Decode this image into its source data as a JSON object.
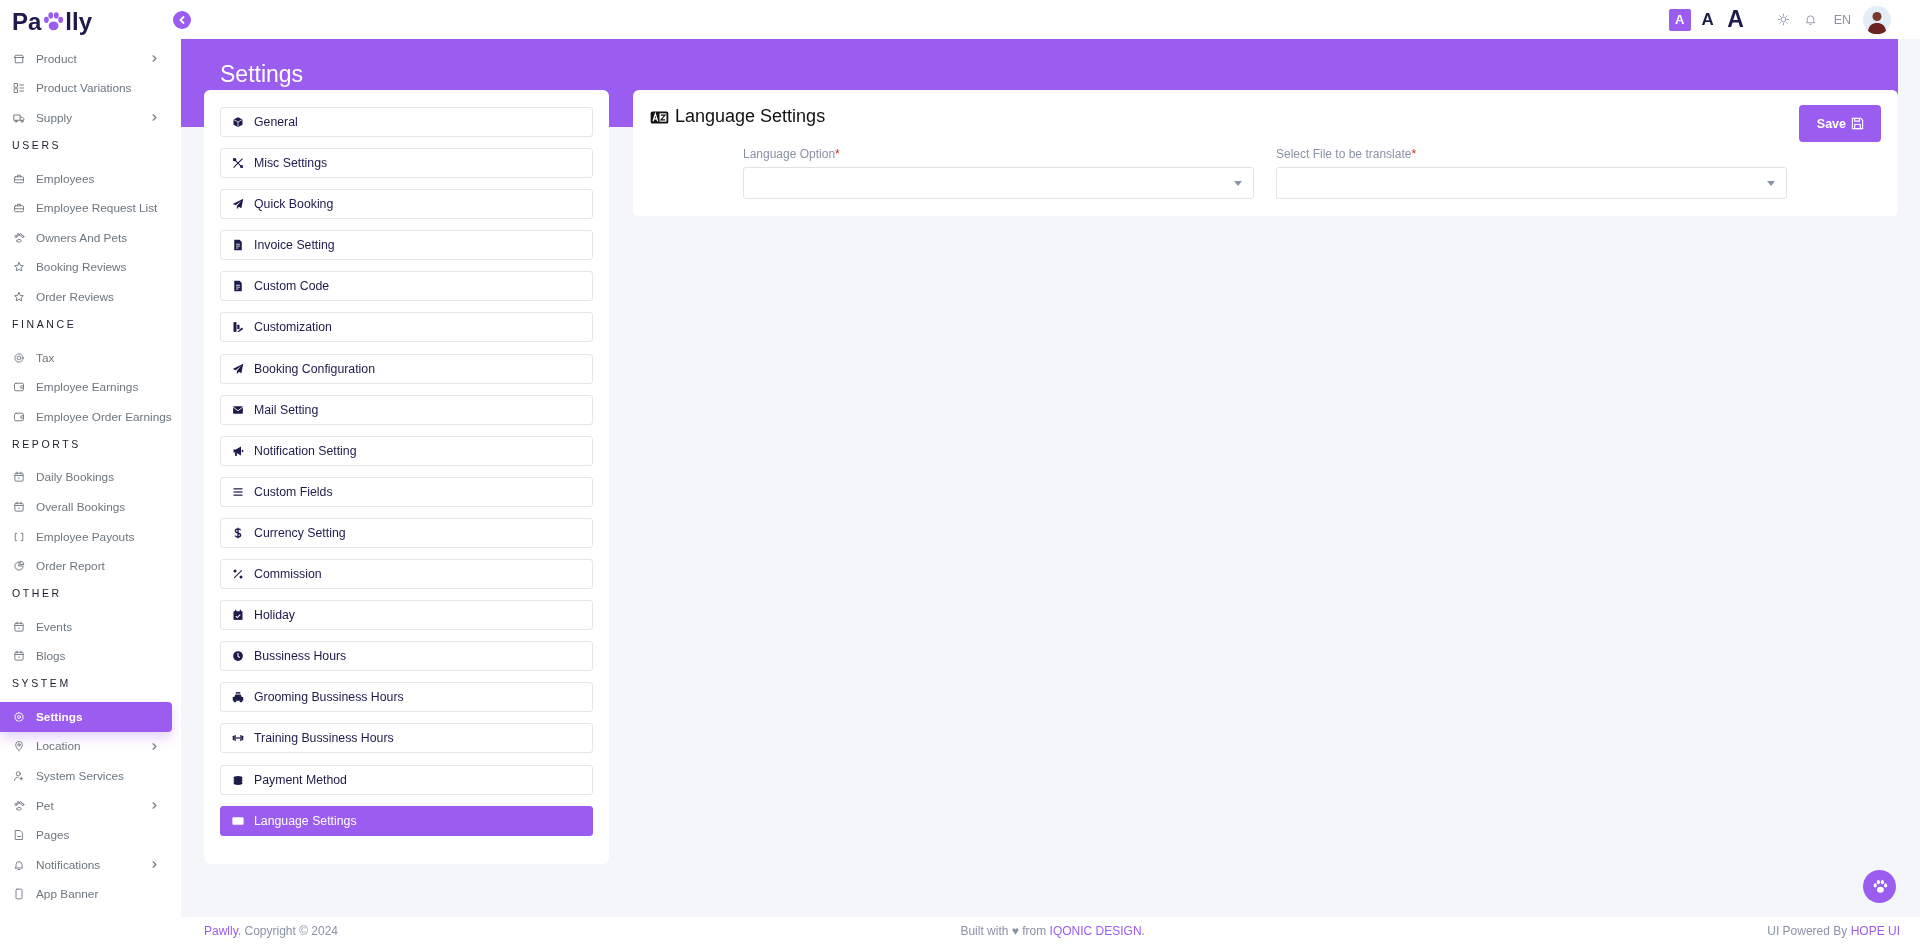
{
  "logo": {
    "parts": [
      "Pa",
      "lly"
    ]
  },
  "header": {
    "font_sizes": [
      {
        "label": "A",
        "selected": true
      },
      {
        "label": "A",
        "selected": false
      },
      {
        "label": "A",
        "selected": false
      }
    ],
    "language": "EN"
  },
  "sidebar": {
    "sections": [
      {
        "items": [
          {
            "label": "Product",
            "has_submenu": true,
            "selected": false
          },
          {
            "label": "Product Variations",
            "has_submenu": false,
            "selected": false
          },
          {
            "label": "Supply",
            "has_submenu": true,
            "selected": false
          }
        ]
      },
      {
        "heading": "USERS",
        "items": [
          {
            "label": "Employees",
            "has_submenu": false,
            "selected": false
          },
          {
            "label": "Employee Request List",
            "has_submenu": false,
            "selected": false
          },
          {
            "label": "Owners And Pets",
            "has_submenu": false,
            "selected": false
          },
          {
            "label": "Booking Reviews",
            "has_submenu": false,
            "selected": false
          },
          {
            "label": "Order Reviews",
            "has_submenu": false,
            "selected": false
          }
        ]
      },
      {
        "heading": "FINANCE",
        "items": [
          {
            "label": "Tax",
            "has_submenu": false,
            "selected": false
          },
          {
            "label": "Employee Earnings",
            "has_submenu": false,
            "selected": false
          },
          {
            "label": "Employee Order Earnings",
            "has_submenu": false,
            "selected": false
          }
        ]
      },
      {
        "heading": "REPORTS",
        "items": [
          {
            "label": "Daily Bookings",
            "has_submenu": false,
            "selected": false
          },
          {
            "label": "Overall Bookings",
            "has_submenu": false,
            "selected": false
          },
          {
            "label": "Employee Payouts",
            "has_submenu": false,
            "selected": false
          },
          {
            "label": "Order Report",
            "has_submenu": false,
            "selected": false
          }
        ]
      },
      {
        "heading": "OTHER",
        "items": [
          {
            "label": "Events",
            "has_submenu": false,
            "selected": false
          },
          {
            "label": "Blogs",
            "has_submenu": false,
            "selected": false
          }
        ]
      },
      {
        "heading": "SYSTEM",
        "items": [
          {
            "label": "Settings",
            "has_submenu": false,
            "selected": true
          },
          {
            "label": "Location",
            "has_submenu": true,
            "selected": false
          },
          {
            "label": "System Services",
            "has_submenu": false,
            "selected": false
          },
          {
            "label": "Pet",
            "has_submenu": true,
            "selected": false
          },
          {
            "label": "Pages",
            "has_submenu": false,
            "selected": false
          },
          {
            "label": "Notifications",
            "has_submenu": true,
            "selected": false
          },
          {
            "label": "App Banner",
            "has_submenu": false,
            "selected": false
          }
        ]
      }
    ]
  },
  "page": {
    "title": "Settings"
  },
  "settings_menu": [
    {
      "label": "General",
      "selected": false
    },
    {
      "label": "Misc Settings",
      "selected": false
    },
    {
      "label": "Quick Booking",
      "selected": false
    },
    {
      "label": "Invoice Setting",
      "selected": false
    },
    {
      "label": "Custom Code",
      "selected": false
    },
    {
      "label": "Customization",
      "selected": false
    },
    {
      "label": "Booking Configuration",
      "selected": false
    },
    {
      "label": "Mail Setting",
      "selected": false
    },
    {
      "label": "Notification Setting",
      "selected": false
    },
    {
      "label": "Custom Fields",
      "selected": false
    },
    {
      "label": "Currency Setting",
      "selected": false
    },
    {
      "label": "Commission",
      "selected": false
    },
    {
      "label": "Holiday",
      "selected": false
    },
    {
      "label": "Bussiness Hours",
      "selected": false
    },
    {
      "label": "Grooming Bussiness Hours",
      "selected": false
    },
    {
      "label": "Training Bussiness Hours",
      "selected": false
    },
    {
      "label": "Payment Method",
      "selected": false
    },
    {
      "label": "Language Settings",
      "selected": true
    }
  ],
  "panel": {
    "title": "Language Settings",
    "save_label": "Save",
    "fields": [
      {
        "label": "Language Option",
        "required_mark": "*"
      },
      {
        "label": "Select File to be translate",
        "required_mark": "*"
      }
    ]
  },
  "footer": {
    "left": {
      "link": "Pawlly",
      "text": ". Copyright © 2024"
    },
    "center": {
      "text": "Built with ♥ from ",
      "link": "IQONIC DESIGN",
      "after": "."
    },
    "right": {
      "text": "UI Powered By ",
      "link": "HOPE UI"
    }
  }
}
